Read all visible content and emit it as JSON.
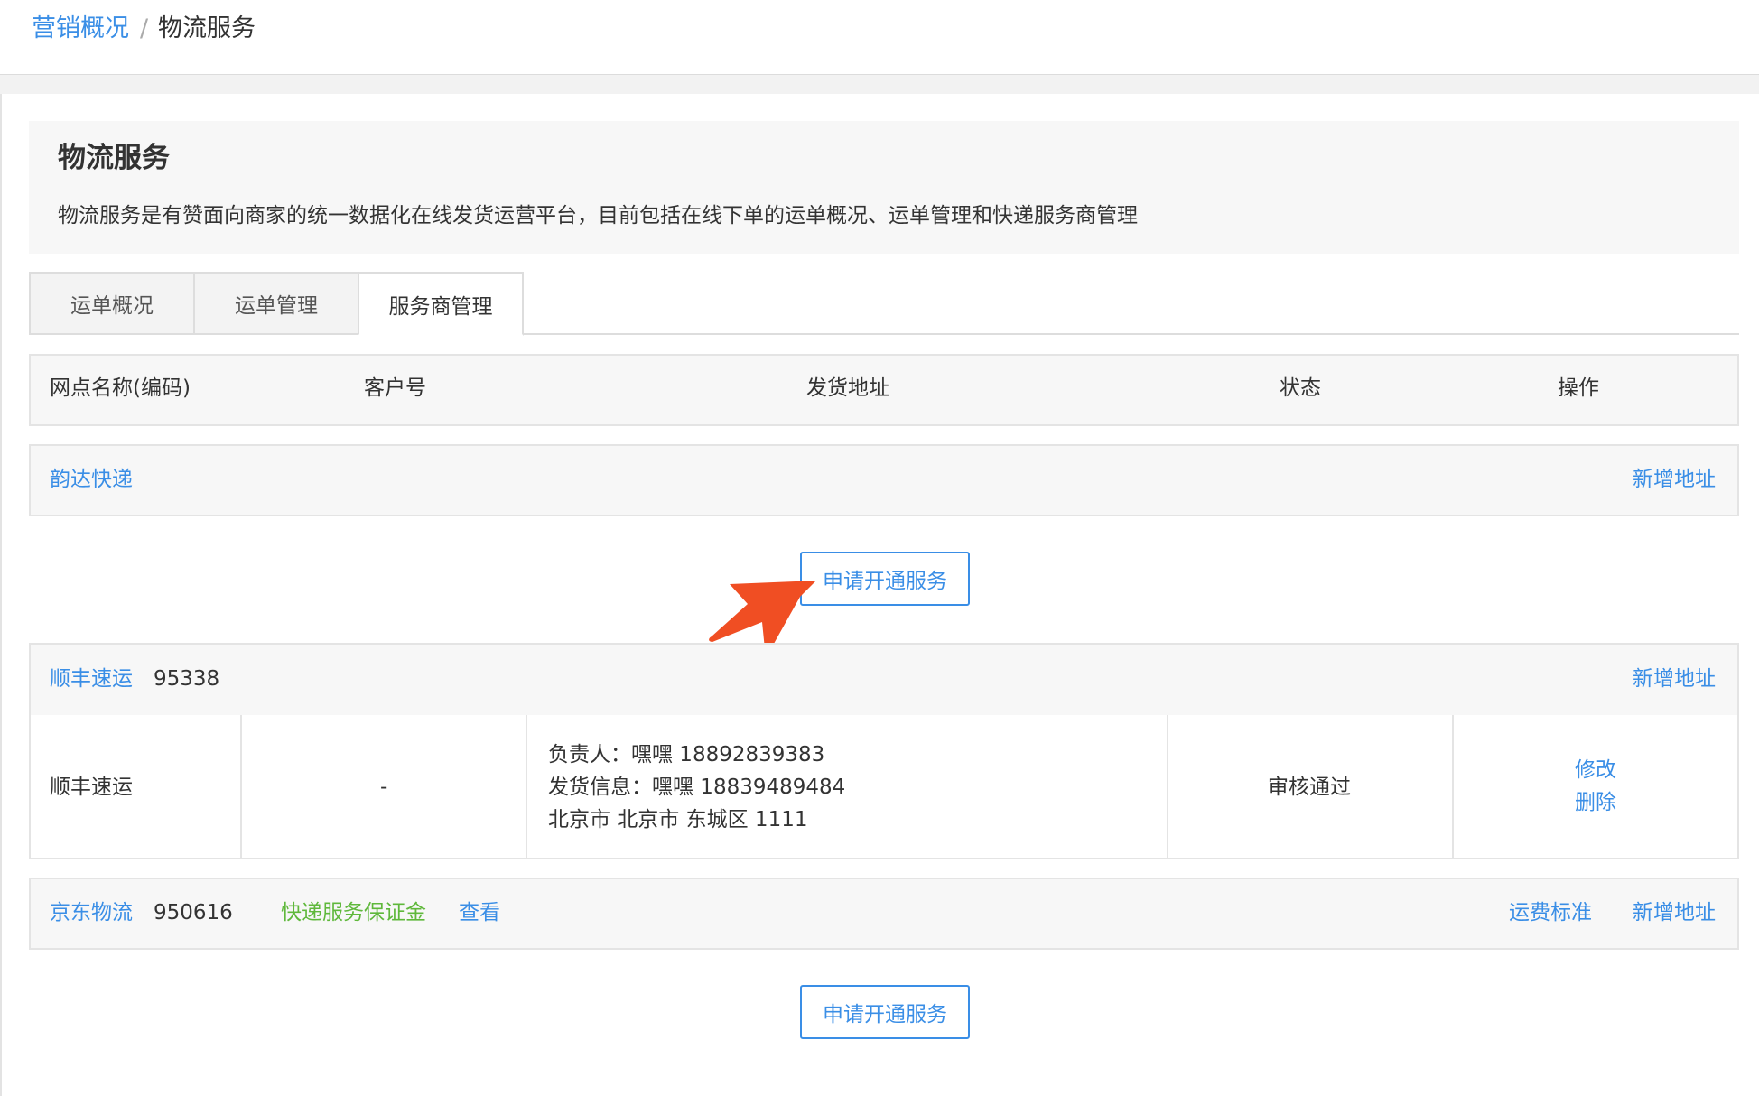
{
  "breadcrumb": {
    "parent": "营销概况",
    "separator": "/",
    "current": "物流服务"
  },
  "page": {
    "title": "物流服务",
    "description": "物流服务是有赞面向商家的统一数据化在线发货运营平台，目前包括在线下单的运单概况、运单管理和快递服务商管理"
  },
  "tabs": [
    {
      "label": "运单概况",
      "active": false
    },
    {
      "label": "运单管理",
      "active": false
    },
    {
      "label": "服务商管理",
      "active": true
    }
  ],
  "table": {
    "headers": [
      "网点名称(编码)",
      "客户号",
      "发货地址",
      "状态",
      "操作"
    ]
  },
  "carriers": {
    "yunda": {
      "name": "韵达快递",
      "add_address": "新增地址",
      "apply_button": "申请开通服务"
    },
    "sf": {
      "name": "顺丰速运",
      "code": "95338",
      "add_address": "新增地址",
      "row": {
        "outlet": "顺丰速运",
        "customer_no": "-",
        "address_lines": [
          "负责人：嘿嘿 18892839383",
          "发货信息：嘿嘿 18839489484",
          "北京市 北京市 东城区 1111"
        ],
        "status": "审核通过",
        "edit": "修改",
        "delete": "删除"
      }
    },
    "jd": {
      "name": "京东物流",
      "code": "950616",
      "deposit_label": "快递服务保证金",
      "view_link": "查看",
      "freight_standard": "运费标准",
      "add_address": "新增地址",
      "apply_button": "申请开通服务"
    }
  },
  "colors": {
    "link": "#3a8ee6",
    "deposit": "#5fb83b",
    "arrow": "#f04e23"
  },
  "annotation": {
    "icon": "arrow-pointer-icon"
  }
}
